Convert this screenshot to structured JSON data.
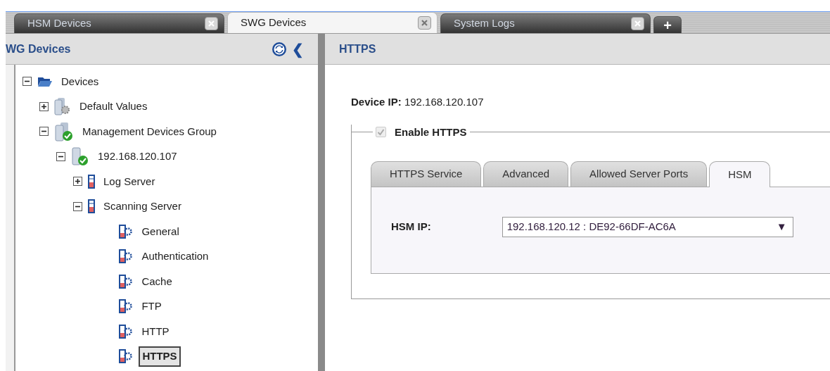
{
  "top_tabs": [
    {
      "label": "HSM Devices",
      "selected": false
    },
    {
      "label": "SWG Devices",
      "selected": true
    },
    {
      "label": "System Logs",
      "selected": false
    }
  ],
  "add_tab": "+",
  "left_panel": {
    "title": "WG Devices",
    "collapse_glyph": "❮",
    "tree": [
      {
        "label": "Devices",
        "kind": "folder",
        "expanded": true,
        "selected": false,
        "children": [
          {
            "label": "Default Values",
            "kind": "defaults",
            "expanded": false,
            "selected": false
          },
          {
            "label": "Management Devices Group",
            "kind": "group",
            "expanded": true,
            "selected": false,
            "children": [
              {
                "label": "192.168.120.107",
                "kind": "device",
                "expanded": true,
                "selected": false,
                "children": [
                  {
                    "label": "Log Server",
                    "kind": "server",
                    "expanded": false,
                    "selected": false
                  },
                  {
                    "label": "Scanning Server",
                    "kind": "server",
                    "expanded": true,
                    "selected": false,
                    "children": [
                      {
                        "label": "General",
                        "kind": "module",
                        "selected": false
                      },
                      {
                        "label": "Authentication",
                        "kind": "module",
                        "selected": false
                      },
                      {
                        "label": "Cache",
                        "kind": "module",
                        "selected": false
                      },
                      {
                        "label": "FTP",
                        "kind": "module",
                        "selected": false
                      },
                      {
                        "label": "HTTP",
                        "kind": "module",
                        "selected": false
                      },
                      {
                        "label": "HTTPS",
                        "kind": "module",
                        "selected": true
                      }
                    ]
                  }
                ]
              }
            ]
          }
        ]
      }
    ]
  },
  "right_panel": {
    "title": "HTTPS",
    "device_ip_label": "Device IP:",
    "device_ip": "192.168.120.107",
    "enable": {
      "label": "Enable HTTPS",
      "checked": true,
      "disabled": true
    },
    "tabs": [
      {
        "label": "HTTPS Service",
        "selected": false
      },
      {
        "label": "Advanced",
        "selected": false
      },
      {
        "label": "Allowed Server Ports",
        "selected": false
      },
      {
        "label": "HSM",
        "selected": true
      }
    ],
    "hsm_ip_label": "HSM IP:",
    "hsm_ip": "192.168.120.12 : DE92-66DF-AC6A",
    "dropdown_glyph": "▼"
  }
}
